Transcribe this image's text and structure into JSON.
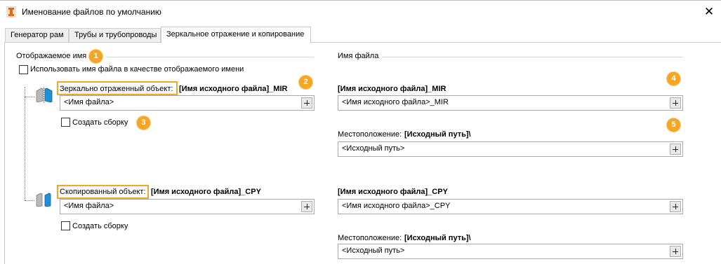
{
  "window": {
    "title": "Именование файлов по умолчанию",
    "close_label": "✕"
  },
  "tabs": [
    {
      "label": "Генератор рам"
    },
    {
      "label": "Трубы и трубопроводы"
    },
    {
      "label": "Зеркальное отражение и копирование"
    }
  ],
  "display_name_group": {
    "title": "Отображаемое имя",
    "use_filename_checkbox": "Использовать имя файла в качестве отображаемого имени"
  },
  "file_name_group": {
    "title": "Имя файла"
  },
  "mirrored": {
    "label": "Зеркально отраженный объект:",
    "pattern": "[Имя исходного файла]_MIR",
    "display_value": "<Имя файла>",
    "create_assembly": "Создать сборку",
    "file_name_heading": "[Имя исходного файла]_MIR",
    "file_name_value": "<Имя исходного файла>_MIR",
    "location_label": "Местоположение:",
    "location_pattern": "[Исходный путь]\\",
    "location_value": "<Исходный путь>"
  },
  "copied": {
    "label": "Скопированный объект:",
    "pattern": "[Имя исходного файла]_CPY",
    "display_value": "<Имя файла>",
    "create_assembly": "Создать сборку",
    "file_name_heading": "[Имя исходного файла]_CPY",
    "file_name_value": "<Имя исходного файла>_CPY",
    "location_label": "Местоположение:",
    "location_pattern": "[Исходный путь]\\",
    "location_value": "<Исходный путь>"
  },
  "callouts": [
    "1",
    "2",
    "3",
    "4",
    "5"
  ],
  "colors": {
    "callout": "#f5a623",
    "icon_blue": "#1e90d6",
    "icon_gray": "#b8b8b8"
  }
}
